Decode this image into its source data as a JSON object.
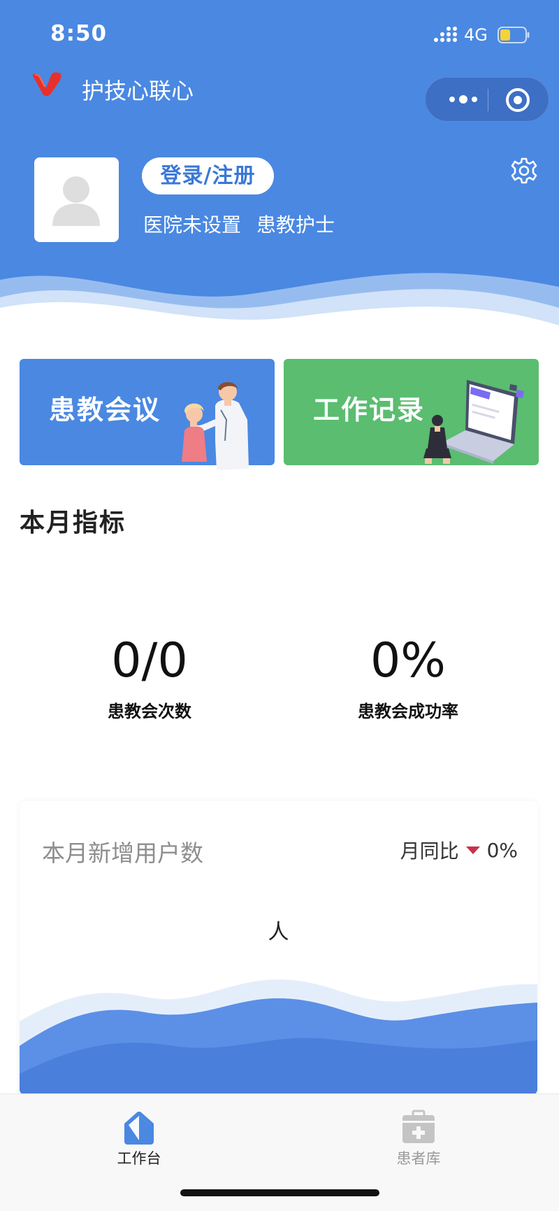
{
  "status_bar": {
    "time": "8:50",
    "network": "4G"
  },
  "app": {
    "title": "护技心联心"
  },
  "profile": {
    "login_label": "登录/注册",
    "hospital": "医院未设置",
    "role": "患教护士"
  },
  "cards": [
    {
      "label": "患教会议"
    },
    {
      "label": "工作记录"
    }
  ],
  "section": {
    "title": "本月指标"
  },
  "metrics": [
    {
      "value": "0/0",
      "label": "患教会次数"
    },
    {
      "value": "0%",
      "label": "患教会成功率"
    }
  ],
  "users_card": {
    "title": "本月新增用户数",
    "compare_label": "月同比",
    "compare_value": "0%",
    "unit": "人"
  },
  "tabbar": {
    "items": [
      {
        "label": "工作台",
        "icon": "workbench-icon",
        "active": true
      },
      {
        "label": "患者库",
        "icon": "medical-kit-icon",
        "active": false
      }
    ]
  },
  "colors": {
    "primary": "#4a88e2",
    "green": "#5abd70",
    "decrease": "#c8334a"
  }
}
